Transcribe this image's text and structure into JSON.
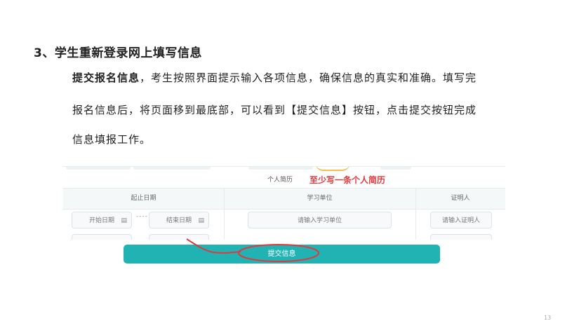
{
  "slide": {
    "heading": "3、学生重新登录网上填写信息",
    "para_bold": "提交报名信息",
    "para_line1_rest": "，考生按照界面提示输入各项信息，确保信息的真实和准确。填写完",
    "para_line2": "报名信息后，将页面移到最底部，可以看到【提交信息】按钮，点击提交按钮完成",
    "para_line3": "信息填报工作。",
    "page_number": "13"
  },
  "form": {
    "section_title": "个人简历",
    "annotation": "至少写一条个人简历",
    "columns": [
      "起止日期",
      "学习单位",
      "证明人"
    ],
    "start_date_placeholder": "开始日期",
    "end_date_placeholder": "结束日期",
    "date_separator": "----",
    "unit_placeholder": "请输入学习单位",
    "witness_placeholder": "请输入证明人",
    "submit_label": "提交信息"
  },
  "colors": {
    "accent": "#21b3b3",
    "annotation_red": "#e0393e",
    "highlight_yellow": "#f2c04b"
  }
}
